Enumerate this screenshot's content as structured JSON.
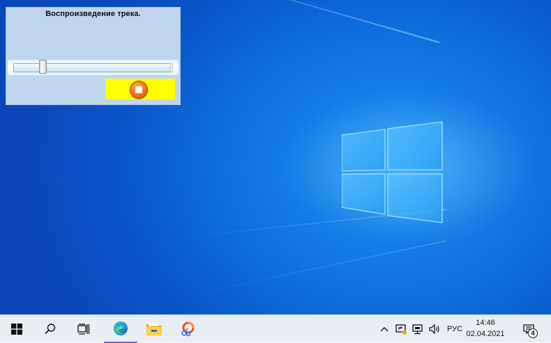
{
  "player": {
    "title": "Воспроизведение трека.",
    "progress_fraction": 0.17,
    "stop_button_color": "#ffff00"
  },
  "taskbar": {
    "start_icon": "windows-logo-icon",
    "search_icon": "search-icon",
    "task_view_icon": "task-view-icon",
    "pinned_apps": [
      "edge-icon",
      "file-explorer-icon",
      "app-icon"
    ],
    "tray": {
      "icons": [
        "chevron-up-icon",
        "screen-share-icon",
        "network-icon",
        "volume-icon"
      ],
      "language": "РУС",
      "time": "14:46",
      "date": "02.04.2021",
      "notification_count": "4"
    }
  },
  "colors": {
    "desktop_blue": "#0f6fde",
    "taskbar_bg": "#e9eef4",
    "active_indicator": "#7a68c8"
  }
}
